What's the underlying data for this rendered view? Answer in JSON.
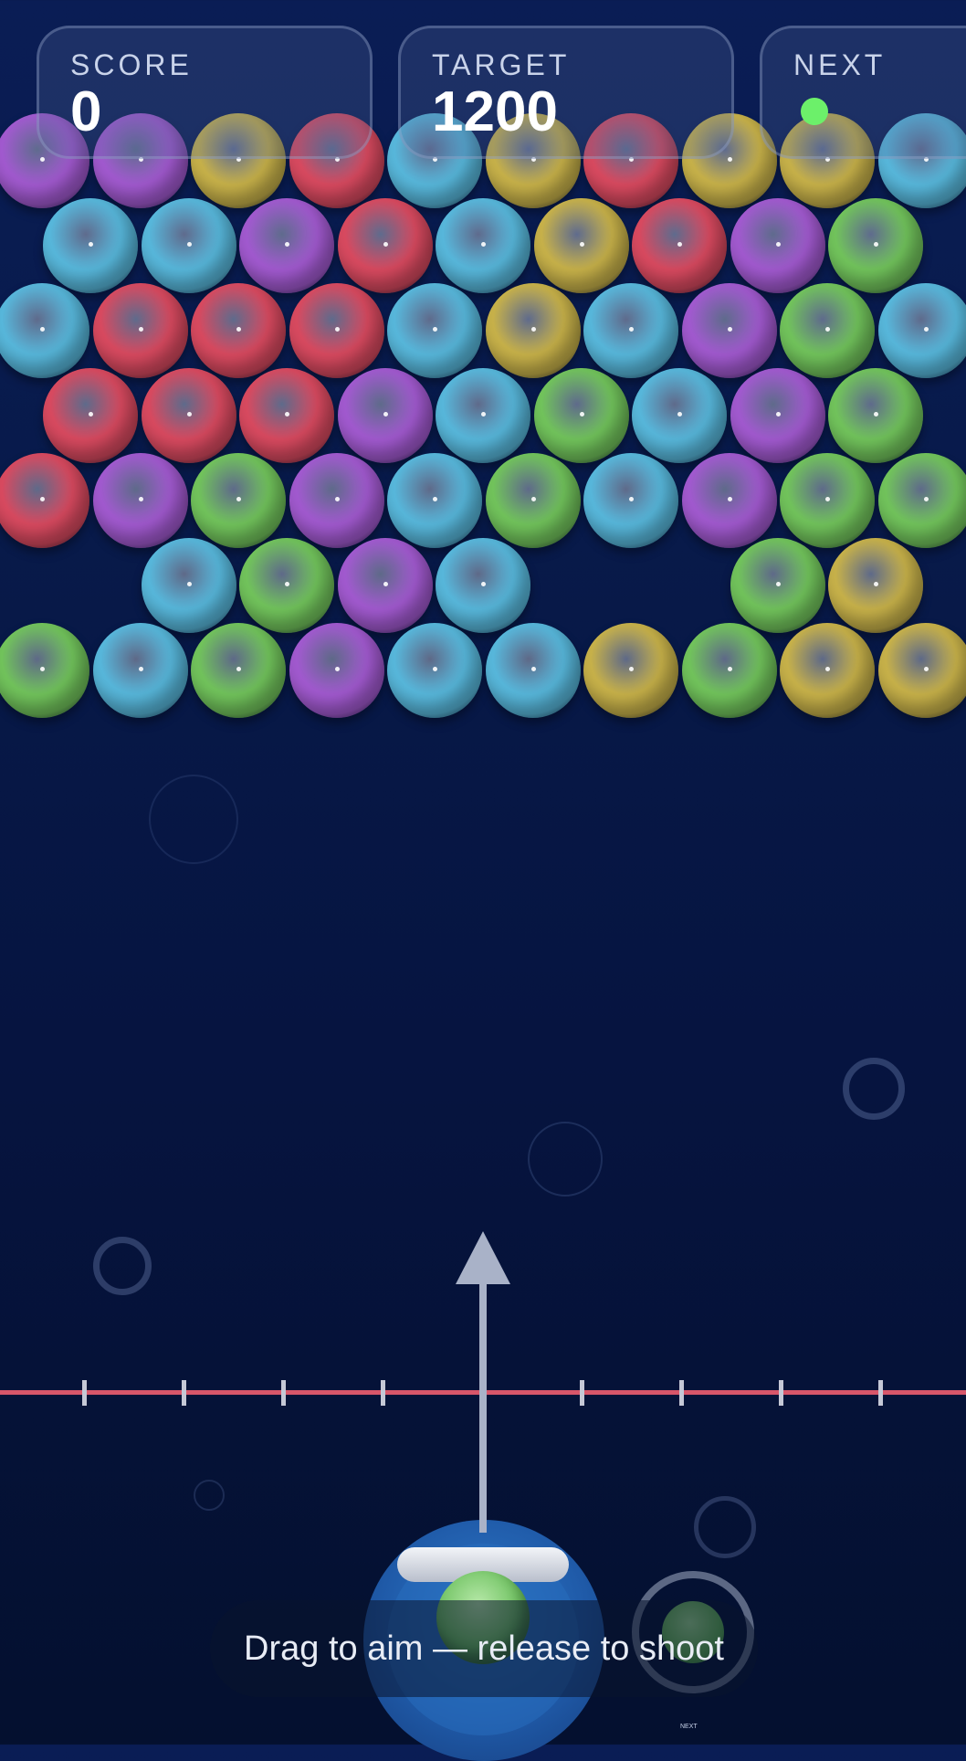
{
  "hud": {
    "score_label": "SCORE",
    "score_value": "0",
    "target_label": "TARGET",
    "target_value": "1200",
    "next_label": "NEXT",
    "next_color": "#6cf06a"
  },
  "colors": {
    "R": "#d94a60",
    "B": "#58b8dc",
    "P": "#a25ad0",
    "G": "#72c45c",
    "Y": "#c8b24a"
  },
  "board": {
    "rows": [
      [
        "P",
        "P",
        "Y",
        "R",
        "B",
        "Y",
        "R",
        "Y",
        "Y",
        "B"
      ],
      [
        "B",
        "B",
        "P",
        "R",
        "B",
        "Y",
        "R",
        "P",
        "G"
      ],
      [
        "B",
        "R",
        "R",
        "R",
        "B",
        "Y",
        "B",
        "P",
        "G",
        "B"
      ],
      [
        "R",
        "R",
        "R",
        "P",
        "B",
        "G",
        "B",
        "P",
        "G"
      ],
      [
        "R",
        "P",
        "G",
        "P",
        "B",
        "G",
        "B",
        "P",
        "G",
        "G"
      ],
      [
        "",
        "B",
        "G",
        "P",
        "B",
        "",
        "",
        "G",
        "Y"
      ],
      [
        "G",
        "B",
        "G",
        "P",
        "B",
        "B",
        "Y",
        "G",
        "Y",
        "Y"
      ]
    ]
  },
  "launcher": {
    "loaded_bubble": "green",
    "next_bubble": "green",
    "next_small_label": "NEXT"
  },
  "hint": {
    "text": "Drag to aim — release to shoot"
  }
}
